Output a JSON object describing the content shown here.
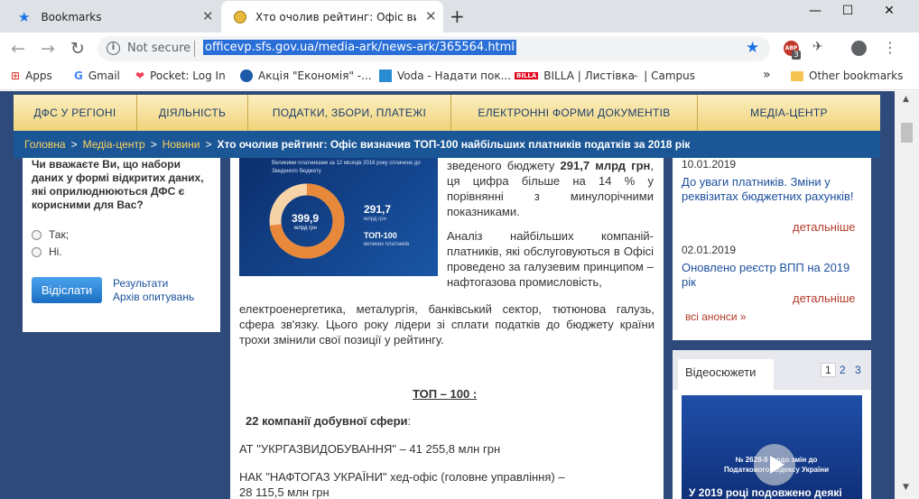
{
  "tabs": [
    {
      "title": "Bookmarks",
      "icon": "star-icon"
    },
    {
      "title": "Хто очолив рейтинг: Офіс визна",
      "icon": "coat-of-arms-icon"
    }
  ],
  "address": {
    "security": "Not secure",
    "url": "officevp.sfs.gov.ua/media-ark/news-ark/365564.html"
  },
  "extensions": {
    "abp_count": "3"
  },
  "bookmarks": [
    {
      "label": "Apps"
    },
    {
      "label": "Gmail"
    },
    {
      "label": "Pocket: Log In"
    },
    {
      "label": "Акція \"Економія\" -..."
    },
    {
      "label": "Voda - Надати пок..."
    },
    {
      "label": "BILLA | Листівка",
      "badge": "BILLA"
    },
    {
      "label": "| Campus"
    }
  ],
  "bookmarks_overflow": "»",
  "other_bookmarks": "Other bookmarks",
  "menu": [
    "ДФС У РЕГІОНІ",
    "ДІЯЛЬНІСТЬ",
    "ПОДАТКИ, ЗБОРИ, ПЛАТЕЖІ",
    "ЕЛЕКТРОННІ ФОРМИ ДОКУМЕНТІВ",
    "МЕДІА-ЦЕНТР"
  ],
  "breadcrumb": {
    "links": [
      "Головна",
      "Медіа-центр",
      "Новини"
    ],
    "separator": ">",
    "current": "Хто очолив рейтинг: Офіс визначив ТОП-100 найбільших платників податків за 2018 рік"
  },
  "poll": {
    "question": "Чи вважаєте Ви, що набори даних у формі відкритих даних, які оприлюднюються ДФС є корисними для Вас?",
    "options": [
      "Так;",
      "Ні."
    ],
    "submit": "Відіслати",
    "results": "Результати",
    "archive": "Архів опитувань"
  },
  "infographic": {
    "caption": "Великими платниками за 12 місяців 2018 року сплачено до Зведеного бюджету",
    "total": "399,9",
    "total_unit": "млрд грн",
    "top_value": "291,7",
    "top_unit": "млрд грн",
    "top_label": "ТОП-100",
    "top_sub": "великих платників",
    "share_top100": 0.73
  },
  "article": {
    "para1_a": "зведеного бюджету ",
    "para1_bold": "291,7 млрд грн",
    "para1_b": ", ця цифра більше на 14 % у порівнянні з минулорічними показниками.",
    "para2_wrap": "Аналіз найбільших компаній-платників, які обслуговуються в Офісі проведено за галузевим принципом – нафтогазова промисловість,",
    "para2_full": "електроенергетика, металургія, банківський сектор, тютюнова галузь, сфера зв'язку. Цього року лідери зі сплати податків до бюджету країни трохи змінили свої позиції у рейтингу.",
    "top_heading": "ТОП – 100 :",
    "section_bold": "22 компанії добувної сфери",
    "section_colon": ":",
    "item1": "АТ \"УКРГАЗВИДОБУВАННЯ\" – 41  255,8 млн грн",
    "item2": "НАК \"НАФТОГАЗ УКРАЇНИ\" хед-офіс  (головне управління) –",
    "item2b": "28 115,5  млн грн"
  },
  "announcements": [
    {
      "date": "10.01.2019",
      "title": "До уваги платників. Зміни у реквізитах бюджетних рахунків!",
      "more": "детальніше"
    },
    {
      "date": "02.01.2019",
      "title": "Оновлено реєстр ВПП на 2019 рік",
      "more": "детальніше"
    }
  ],
  "all_announcements": "всі анонси",
  "all_announcements_arrow": "»",
  "video": {
    "tab": "Відеосюжети",
    "pages": [
      "1",
      "2",
      "3"
    ],
    "thumb_text": "№ 2628-8 щодо змін до Податкового кодексу України",
    "caption": "У 2019 році подовжено деякі"
  },
  "colors": {
    "nav_blue": "#1b5796",
    "page_bg": "#2d4a7a",
    "menu_gold": "#f0d37a",
    "crumb_link": "#ffd45c",
    "link": "#1b4f9c",
    "more_link": "#b23a2a"
  }
}
